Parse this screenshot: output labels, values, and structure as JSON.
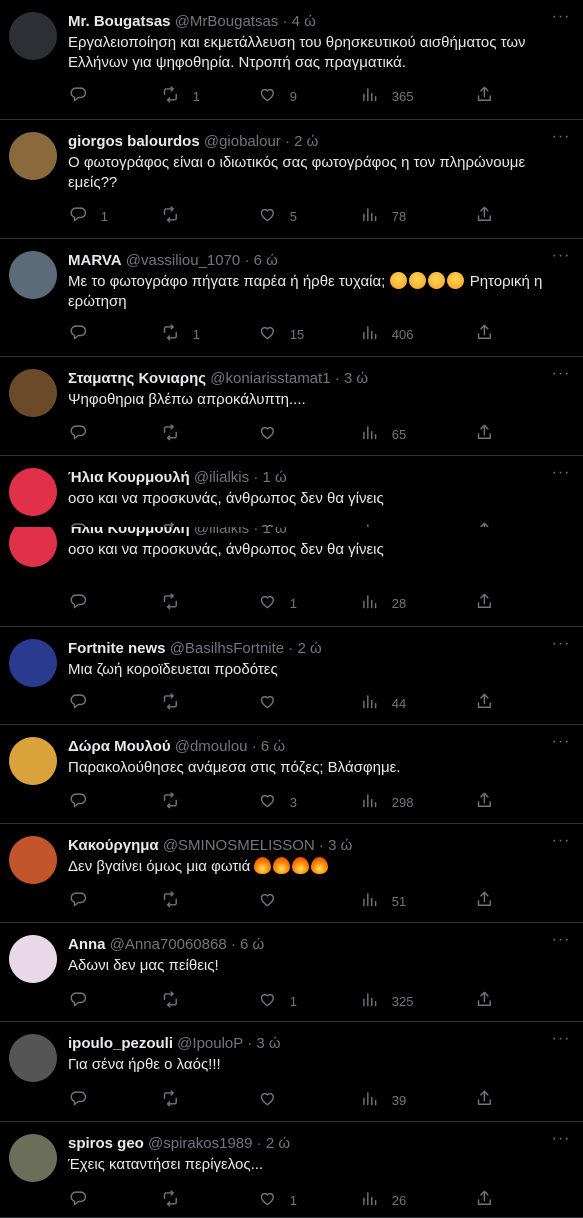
{
  "icons": {
    "reply": "reply-icon",
    "retweet": "retweet-icon",
    "like": "heart-icon",
    "views": "views-icon",
    "share": "share-icon",
    "more": "more-icon"
  },
  "tweets": [
    {
      "name": "Mr. Bougatsas",
      "handle": "@MrBougatsas",
      "dot": "·",
      "time": "4 ώ",
      "text": "Εργαλειοποίηση και εκμετάλλευση του θρησκευτικού αισθήματος των Ελλήνων για ψηφοθηρία. Ντροπή σας πραγματικά.",
      "replies": "",
      "retweets": "1",
      "likes": "9",
      "views": "365",
      "avatar_color": "#2c2f33"
    },
    {
      "name": "giorgos balourdos",
      "handle": "@giobalour",
      "dot": "·",
      "time": "2 ώ",
      "text": "Ο φωτογράφος είναι ο ιδιωτικός σας φωτογράφος η τον πληρώνουμε εμείς??",
      "replies": "1",
      "retweets": "",
      "likes": "5",
      "views": "78",
      "avatar_color": "#8a6a3d"
    },
    {
      "name": "MARVA",
      "handle": "@vassiliou_1070",
      "dot": "·",
      "time": "6 ώ",
      "text": "Με το φωτογράφο πήγατε παρέα ή ήρθε τυχαία;",
      "text_suffix": "Ρητορική η ερώτηση",
      "emoji": "rofl",
      "emoji_count": 4,
      "replies": "",
      "retweets": "1",
      "likes": "15",
      "views": "406",
      "avatar_color": "#5c6b78"
    },
    {
      "name": "Σταματης Κονιαρης",
      "handle": "@koniarisstamat1",
      "dot": "·",
      "time": "3 ώ",
      "text": "Ψηφοθηρια βλέπω απροκάλυπτη....",
      "replies": "",
      "retweets": "",
      "likes": "",
      "views": "65",
      "avatar_color": "#6b4a2a"
    },
    {
      "name": "Ήλια Κουρμουλή",
      "handle": "@ilialkis",
      "dot": "·",
      "time": "1 ώ",
      "text": "οσο και να προσκυνάς, άνθρωπος δεν θα γίνεις",
      "replies": "",
      "retweets": "",
      "likes": "1",
      "views": "28",
      "avatar_color": "#e0304a"
    },
    {
      "name": "Ήλια Κουρμουλή",
      "handle": "@ilialkis",
      "dot": "·",
      "time": "1 ώ",
      "text": "οσο και να προσκυνάς, άνθρωπος δεν θα γίνεις",
      "replies": "",
      "retweets": "",
      "likes": "1",
      "views": "28",
      "avatar_color": "#e0304a"
    },
    {
      "name": "Fortnite news",
      "handle": "@BasilhsFortnite",
      "dot": "·",
      "time": "2 ώ",
      "text": "Μια ζωή κοροϊδευεται προδότες",
      "replies": "",
      "retweets": "",
      "likes": "",
      "views": "44",
      "avatar_color": "#2a3b8f"
    },
    {
      "name": "Δώρα Μουλού",
      "handle": "@dmoulou",
      "dot": "·",
      "time": "6 ώ",
      "text": "Παρακολούθησες ανάμεσα στις πόζες; Βλάσφημε.",
      "replies": "",
      "retweets": "",
      "likes": "3",
      "views": "298",
      "avatar_color": "#d9a23a"
    },
    {
      "name": "Κακούργημα",
      "handle": "@SMINOSMELISSON",
      "dot": "·",
      "time": "3 ώ",
      "text": "Δεν βγαίνει όμως μια φωτιά",
      "emoji": "fire",
      "emoji_count": 4,
      "replies": "",
      "retweets": "",
      "likes": "",
      "views": "51",
      "avatar_color": "#c2552a"
    },
    {
      "name": "Anna",
      "handle": "@Anna70060868",
      "dot": "·",
      "time": "6 ώ",
      "text": "Αδωνι δεν μας πείθεις!",
      "replies": "",
      "retweets": "",
      "likes": "1",
      "views": "325",
      "avatar_color": "#e8d8e8"
    },
    {
      "name": "ipoulo_pezouli",
      "handle": "@IpouloP",
      "dot": "·",
      "time": "3 ώ",
      "text": "Για σένα ήρθε ο λαός!!!",
      "replies": "",
      "retweets": "",
      "likes": "",
      "views": "39",
      "avatar_color": "#555555"
    },
    {
      "name": "spiros geo",
      "handle": "@spirakos1989",
      "dot": "·",
      "time": "2 ώ",
      "text": "Έχεις καταντήσει περίγελος...",
      "replies": "",
      "retweets": "",
      "likes": "1",
      "views": "26",
      "avatar_color": "#6b6f5a"
    }
  ]
}
